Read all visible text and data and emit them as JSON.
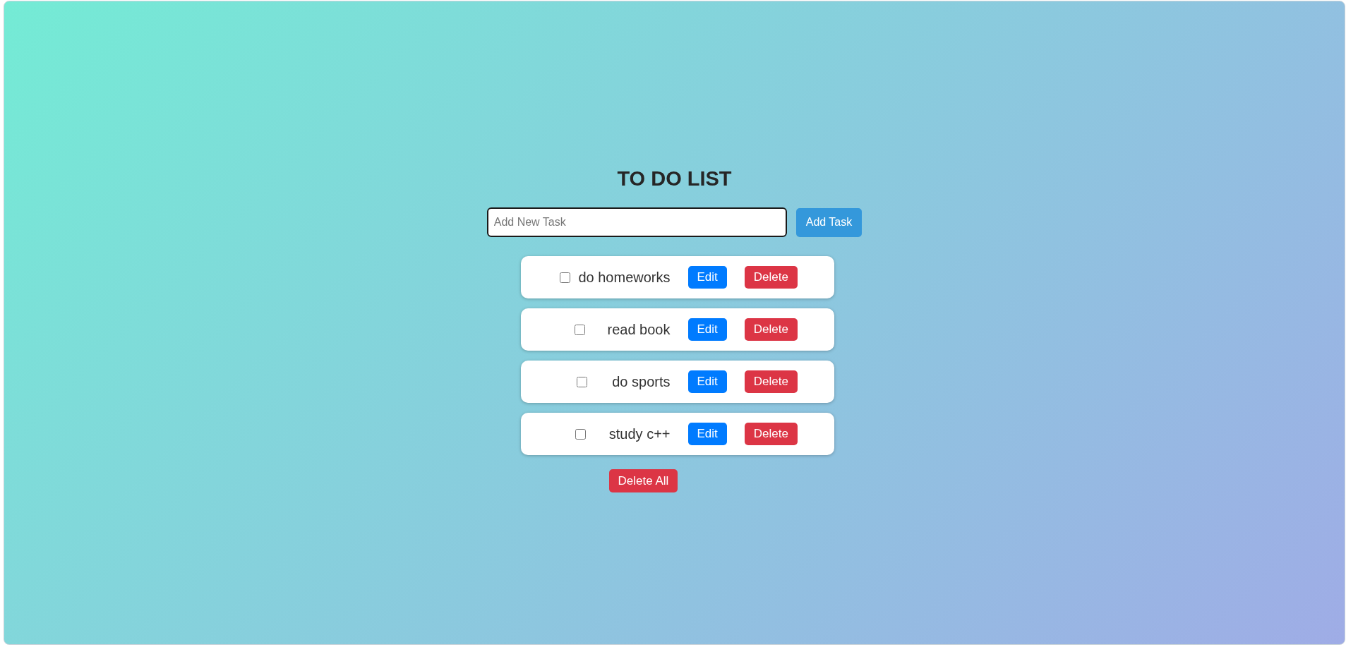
{
  "title": "TO DO LIST",
  "new_task": {
    "placeholder": "Add New Task",
    "button": "Add Task"
  },
  "tasks": [
    {
      "text": "do homeworks",
      "checked": false,
      "edit": "Edit",
      "delete": "Delete"
    },
    {
      "text": "read book",
      "checked": false,
      "edit": "Edit",
      "delete": "Delete"
    },
    {
      "text": "do sports",
      "checked": false,
      "edit": "Edit",
      "delete": "Delete"
    },
    {
      "text": "study c++",
      "checked": false,
      "edit": "Edit",
      "delete": "Delete"
    }
  ],
  "delete_all": "Delete All"
}
